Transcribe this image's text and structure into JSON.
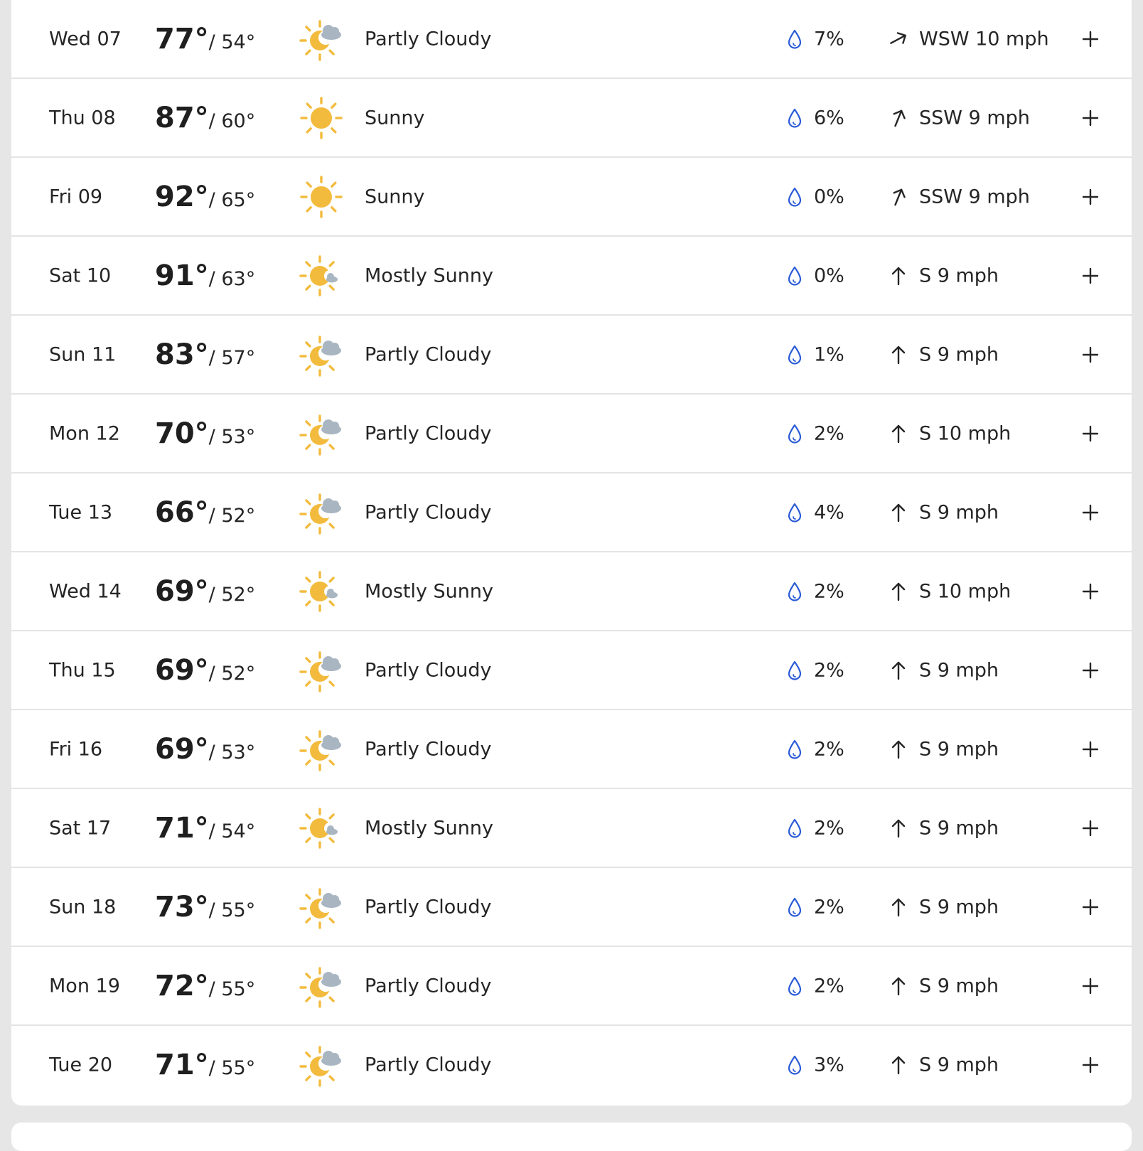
{
  "colors": {
    "sun": "#f3bb3d",
    "cloud": "#a9b6c2",
    "drop": "#2a5bd7",
    "text": "#252525",
    "divider": "#e4e4e4"
  },
  "days": [
    {
      "day": "Wed 07",
      "hi": "77°",
      "lo": "/ 54°",
      "icon": "partly-cloudy-icon",
      "condition": "Partly Cloudy",
      "precip": "7%",
      "wind": "WSW 10 mph",
      "wind_dir": "WSW"
    },
    {
      "day": "Thu 08",
      "hi": "87°",
      "lo": "/ 60°",
      "icon": "sunny-icon",
      "condition": "Sunny",
      "precip": "6%",
      "wind": "SSW 9 mph",
      "wind_dir": "SSW"
    },
    {
      "day": "Fri 09",
      "hi": "92°",
      "lo": "/ 65°",
      "icon": "sunny-icon",
      "condition": "Sunny",
      "precip": "0%",
      "wind": "SSW 9 mph",
      "wind_dir": "SSW"
    },
    {
      "day": "Sat 10",
      "hi": "91°",
      "lo": "/ 63°",
      "icon": "mostly-sunny-icon",
      "condition": "Mostly Sunny",
      "precip": "0%",
      "wind": "S 9 mph",
      "wind_dir": "S"
    },
    {
      "day": "Sun 11",
      "hi": "83°",
      "lo": "/ 57°",
      "icon": "partly-cloudy-icon",
      "condition": "Partly Cloudy",
      "precip": "1%",
      "wind": "S 9 mph",
      "wind_dir": "S"
    },
    {
      "day": "Mon 12",
      "hi": "70°",
      "lo": "/ 53°",
      "icon": "partly-cloudy-icon",
      "condition": "Partly Cloudy",
      "precip": "2%",
      "wind": "S 10 mph",
      "wind_dir": "S"
    },
    {
      "day": "Tue 13",
      "hi": "66°",
      "lo": "/ 52°",
      "icon": "partly-cloudy-icon",
      "condition": "Partly Cloudy",
      "precip": "4%",
      "wind": "S 9 mph",
      "wind_dir": "S"
    },
    {
      "day": "Wed 14",
      "hi": "69°",
      "lo": "/ 52°",
      "icon": "mostly-sunny-icon",
      "condition": "Mostly Sunny",
      "precip": "2%",
      "wind": "S 10 mph",
      "wind_dir": "S"
    },
    {
      "day": "Thu 15",
      "hi": "69°",
      "lo": "/ 52°",
      "icon": "partly-cloudy-icon",
      "condition": "Partly Cloudy",
      "precip": "2%",
      "wind": "S 9 mph",
      "wind_dir": "S"
    },
    {
      "day": "Fri 16",
      "hi": "69°",
      "lo": "/ 53°",
      "icon": "partly-cloudy-icon",
      "condition": "Partly Cloudy",
      "precip": "2%",
      "wind": "S 9 mph",
      "wind_dir": "S"
    },
    {
      "day": "Sat 17",
      "hi": "71°",
      "lo": "/ 54°",
      "icon": "mostly-sunny-icon",
      "condition": "Mostly Sunny",
      "precip": "2%",
      "wind": "S 9 mph",
      "wind_dir": "S"
    },
    {
      "day": "Sun 18",
      "hi": "73°",
      "lo": "/ 55°",
      "icon": "partly-cloudy-icon",
      "condition": "Partly Cloudy",
      "precip": "2%",
      "wind": "S 9 mph",
      "wind_dir": "S"
    },
    {
      "day": "Mon 19",
      "hi": "72°",
      "lo": "/ 55°",
      "icon": "partly-cloudy-icon",
      "condition": "Partly Cloudy",
      "precip": "2%",
      "wind": "S 9 mph",
      "wind_dir": "S"
    },
    {
      "day": "Tue 20",
      "hi": "71°",
      "lo": "/ 55°",
      "icon": "partly-cloudy-icon",
      "condition": "Partly Cloudy",
      "precip": "3%",
      "wind": "S 9 mph",
      "wind_dir": "S"
    }
  ]
}
